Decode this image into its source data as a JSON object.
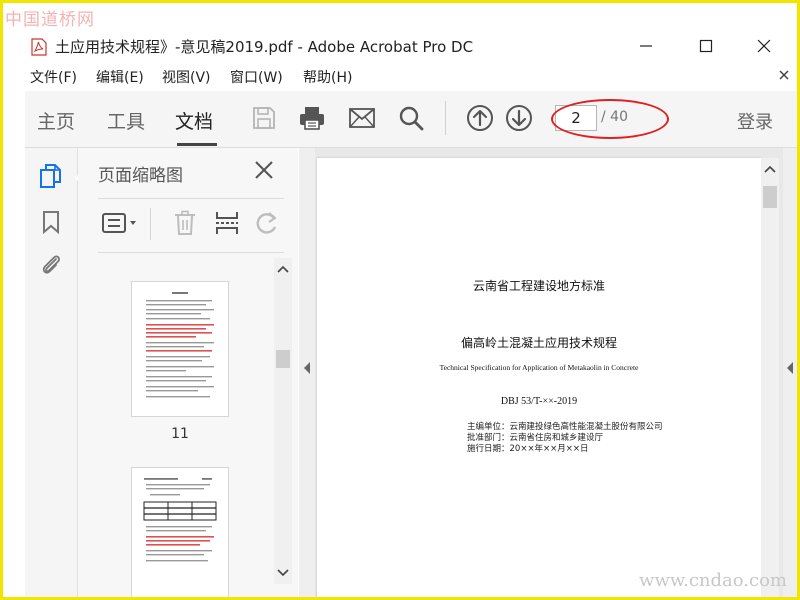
{
  "watermarks": {
    "top": "中国道桥网",
    "bottom": "www.cndao.com"
  },
  "window": {
    "title": "土应用技术规程》-意见稿2019.pdf - Adobe Acrobat Pro DC"
  },
  "menu": {
    "items": [
      "文件(F)",
      "编辑(E)",
      "视图(V)",
      "窗口(W)",
      "帮助(H)"
    ]
  },
  "toolbar": {
    "tabs": [
      "主页",
      "工具",
      "文档"
    ],
    "active_tab": "文档",
    "page_current": "2",
    "page_total": "/ 40",
    "login": "登录"
  },
  "thumbnails_panel": {
    "title": "页面缩略图",
    "thumb1_label": "11"
  },
  "document": {
    "header": "云南省工程建设地方标准",
    "title_cn": "偏高岭土混凝土应用技术规程",
    "title_en": "Technical Specification for Application of Metakaolin in Concrete",
    "code": "DBJ 53/T-××-2019",
    "meta": [
      "主编单位：云南建投绿色高性能混凝土股份有限公司",
      "批准部门：云南省住房和城乡建设厅",
      "施行日期：20××年××月××日"
    ]
  },
  "colors": {
    "frame": "#f2e600",
    "annotation": "#e02020",
    "active_icon": "#1473e6"
  }
}
